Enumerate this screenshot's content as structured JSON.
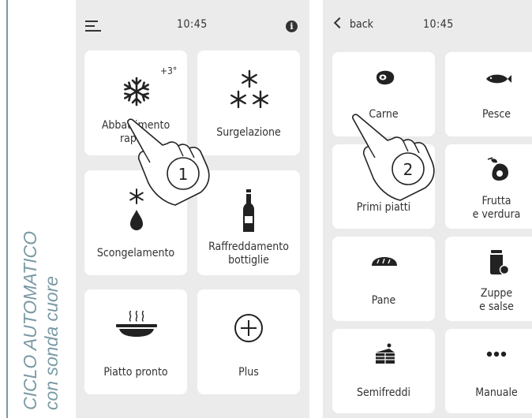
{
  "side_title": {
    "line1": "CICLO AUTOMATICO",
    "line2": "con sonda cuore"
  },
  "screen1": {
    "time": "10:45",
    "icons": {
      "menu": "menu-icon",
      "info": "info-icon"
    },
    "cards": [
      {
        "id": "abbattimento",
        "label": "Abbattimento\nrapido",
        "badge": "+3°",
        "icon": "snowflake-icon"
      },
      {
        "id": "surgelazione",
        "label": "Surgelazione",
        "icon": "triple-snowflake-icon"
      },
      {
        "id": "scongelamento",
        "label": "Scongelamento",
        "icon": "snowflake-drop-icon"
      },
      {
        "id": "raffreddamento",
        "label": "Raffreddamento\nbottiglie",
        "icon": "bottle-icon"
      },
      {
        "id": "piatto",
        "label": "Piatto pronto",
        "icon": "hot-dish-icon"
      },
      {
        "id": "plus",
        "label": "Plus",
        "icon": "plus-circle-icon"
      }
    ],
    "step": "1"
  },
  "screen2": {
    "back_label": "back",
    "time": "10:45",
    "cards": [
      {
        "id": "carne",
        "label": "Carne",
        "icon": "steak-icon"
      },
      {
        "id": "pesce",
        "label": "Pesce",
        "icon": "fish-icon"
      },
      {
        "id": "primi",
        "label": "Primi piatti",
        "icon": "pasta-icon"
      },
      {
        "id": "frutta",
        "label": "Frutta\ne verdura",
        "icon": "fruit-icon"
      },
      {
        "id": "pane",
        "label": "Pane",
        "icon": "bread-icon"
      },
      {
        "id": "zuppe",
        "label": "Zuppe\ne salse",
        "icon": "jar-icon"
      },
      {
        "id": "semifreddi",
        "label": "Semifreddi",
        "icon": "cake-icon"
      },
      {
        "id": "manuale",
        "label": "Manuale",
        "icon": "dots-icon"
      }
    ],
    "step": "2"
  }
}
